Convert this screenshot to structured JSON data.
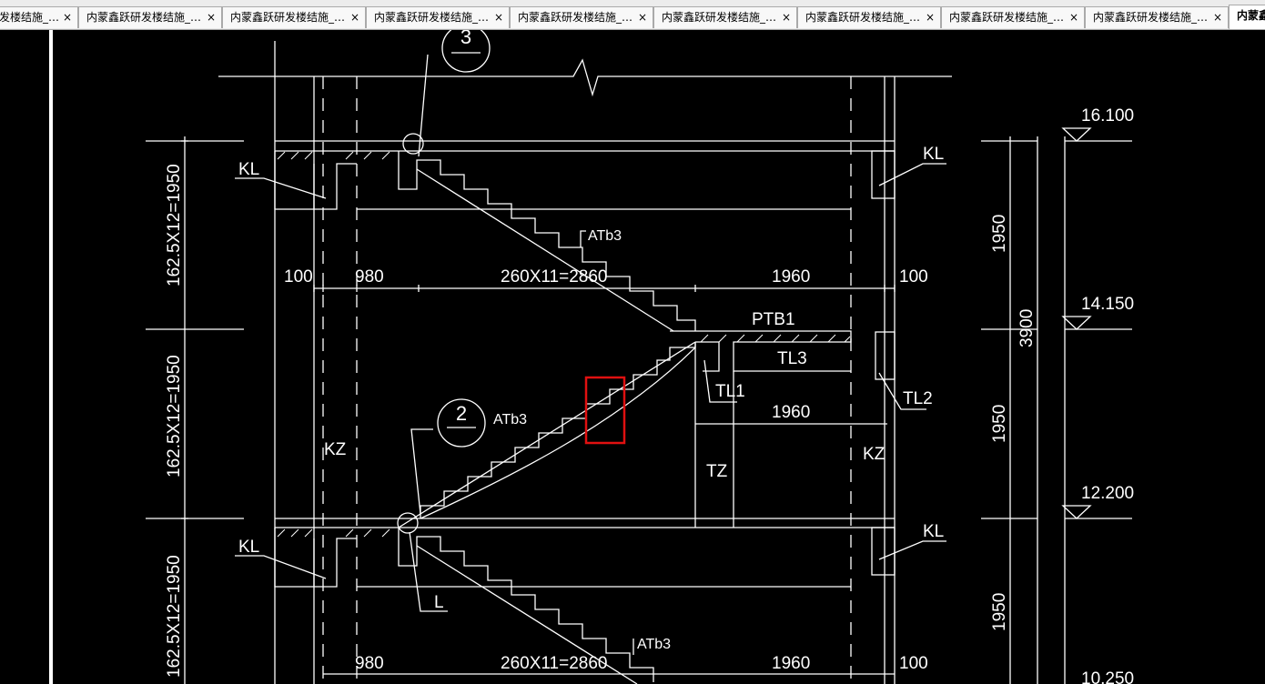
{
  "tabs": [
    {
      "label": "发楼结施_…"
    },
    {
      "label": "内蒙鑫跃研发楼结施_…"
    },
    {
      "label": "内蒙鑫跃研发楼结施_…"
    },
    {
      "label": "内蒙鑫跃研发楼结施_…"
    },
    {
      "label": "内蒙鑫跃研发楼结施_…"
    },
    {
      "label": "内蒙鑫跃研发楼结施_…"
    },
    {
      "label": "内蒙鑫跃研发楼结施_…"
    },
    {
      "label": "内蒙鑫跃研发楼结施_…"
    },
    {
      "label": "内蒙鑫跃研发楼结施_…"
    },
    {
      "label": "内蒙鑫"
    }
  ],
  "close_glyph": "×",
  "drawing": {
    "section_marks": [
      "3",
      "2"
    ],
    "labels": {
      "kl": "KL",
      "kz": "KZ",
      "atb3": "ATb3",
      "ptb1": "PTB1",
      "tl1": "TL1",
      "tl2": "TL2",
      "tl3": "TL3",
      "tz": "TZ",
      "l": "L"
    },
    "dimensions": {
      "d100": "100",
      "d980": "980",
      "d1960": "1960",
      "stair_run": "260X11=2860",
      "flight_height": "162.5X12=1950",
      "d1950": "1950",
      "d3900": "3900"
    },
    "elevations": [
      "16.100",
      "14.150",
      "12.200",
      "10.250"
    ],
    "highlight_color": "#e01010"
  }
}
